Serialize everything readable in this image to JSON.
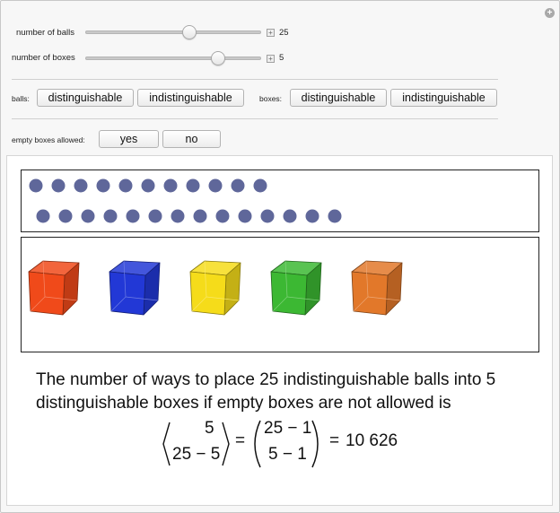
{
  "controls": {
    "balls_slider": {
      "label": "number of balls",
      "value": "25",
      "fraction": 0.6
    },
    "boxes_slider": {
      "label": "number of boxes",
      "value": "5",
      "fraction": 0.78
    },
    "balls_toggle": {
      "label": "balls:",
      "options": [
        "distinguishable",
        "indistinguishable"
      ]
    },
    "boxes_toggle": {
      "label": "boxes:",
      "options": [
        "distinguishable",
        "indistinguishable"
      ]
    },
    "empty_toggle": {
      "label": "empty boxes allowed:",
      "options": [
        "yes",
        "no"
      ]
    }
  },
  "balls": {
    "count": 25,
    "color": "#5f679a"
  },
  "boxes": [
    {
      "color": "#f04a1a"
    },
    {
      "color": "#2238d6"
    },
    {
      "color": "#f5dc1a"
    },
    {
      "color": "#3cb833"
    },
    {
      "color": "#e2782a"
    }
  ],
  "result": {
    "statement": "The number of ways to place 25 indistinguishable balls into 5 distinguishable boxes if empty boxes are not allowed is",
    "lhs_top": "5",
    "lhs_bottom": "25 − 5",
    "equals1": "=",
    "rhs_top": "25 − 1",
    "rhs_bottom": "5 − 1",
    "equals2": "=",
    "answer": "10 626"
  }
}
